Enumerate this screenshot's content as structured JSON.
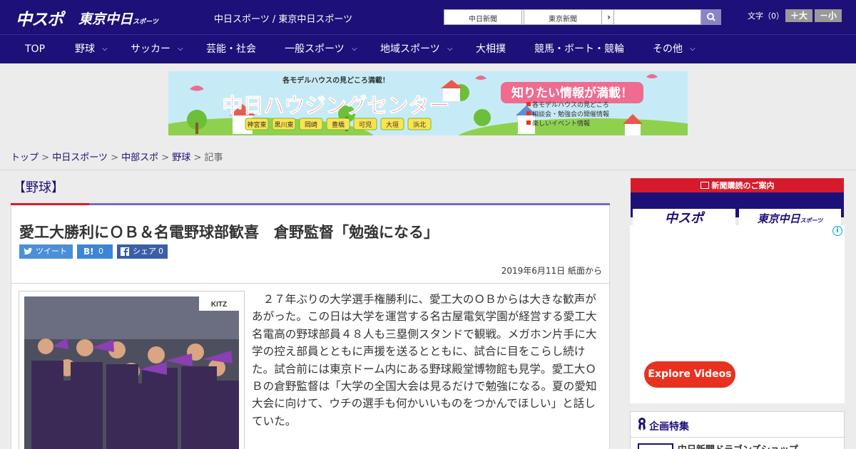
{
  "header": {
    "logo_main": "中スポ",
    "logo_sub": "東京中日",
    "logo_sub_small": "スポーツ",
    "site_title": "中日スポーツ / 東京中日スポーツ",
    "btn_chunichi": "中日新聞",
    "btn_tokyo": "東京新聞",
    "btn_arrow": "›",
    "search_placeholder": "",
    "text_size_label": "文字（0）",
    "size_up": "＋大",
    "size_down": "－小"
  },
  "nav": {
    "items": [
      {
        "label": "TOP"
      },
      {
        "label": "野球"
      },
      {
        "label": "サッカー"
      },
      {
        "label": "芸能・社会"
      },
      {
        "label": "一般スポーツ"
      },
      {
        "label": "地域スポーツ"
      },
      {
        "label": "大相撲"
      },
      {
        "label": "競馬・ボート・競輪"
      },
      {
        "label": "その他"
      }
    ],
    "chevron": "⌵"
  },
  "banner": {
    "top_line": "各モデルハウスの見どころ満載！",
    "title": "中日ハウジングセンター",
    "bubble": "知りたい情報が満載！",
    "bullet1": "各モデルハウスの見どころ",
    "bullet2": "相談会・勉強会の開催情報",
    "bullet3": "楽しいイベント情報",
    "locations": [
      "神宮東",
      "黒川東",
      "岡崎",
      "豊橋",
      "可児",
      "大垣",
      "浜北"
    ]
  },
  "breadcrumb": {
    "items": [
      "トップ",
      "中日スポーツ",
      "中部スポ",
      "野球"
    ],
    "separator": " > ",
    "current": "記事"
  },
  "article": {
    "category": "【野球】",
    "headline": "愛工大勝利にＯＢ＆名電野球部歓喜　倉野監督「勉強になる」",
    "share_tweet": "ツイート",
    "share_hatena": "B!",
    "share_hatena_count": "0",
    "share_fb": "シェア",
    "share_fb_count": "0",
    "date": "2019年6月11日 紙面から",
    "body": "２７年ぶりの大学選手権勝利に、愛工大のＯＢからは大きな歓声があがった。この日は大学を運営する名古屋電気学園が経営する愛工大名電高の野球部員４８人も三塁側スタンドで観戦。メガホン片手に大学の控え部員とともに声援を送るとともに、試合に目をこらし続けた。試合前には東京ドーム内にある野球殿堂博物館も見学。愛工大ＯＢの倉野監督は「大学の全国大会は見るだけで勉強になる。夏の愛知大会に向けて、ウチの選手も何かいいものをつかんでほしい」と話していた。",
    "photo_sign": "KITZ"
  },
  "sidebar": {
    "subscribe_title": "新聞購読のご案内",
    "sub_logo1": "中スポ",
    "sub_logo2": "東京中日",
    "sub_logo2_small": "スポーツ",
    "ad_info": "i",
    "explore_label": "Explore Videos",
    "feature_title": "企画特集",
    "feature_item": "中日新聞ドラゴンズショップ"
  },
  "colors": {
    "brand_navy": "#1d1078",
    "accent_red": "#d81b2b",
    "accent_purple": "#7b6cb4",
    "share_blue": "#4a8fd8",
    "explore_red": "#e8321f"
  }
}
